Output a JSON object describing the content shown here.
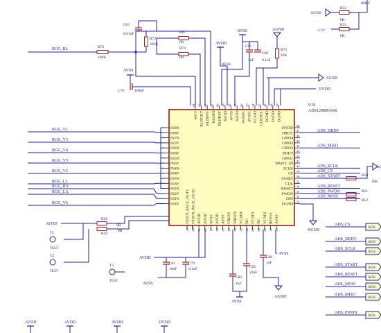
{
  "colors": {
    "wire": "#1c1ca8",
    "component": "#a81c1c",
    "label": "#1c1c80",
    "chip_fill": "#fffdc0",
    "chip_border": "#8a1010",
    "pin": "#1c1c1c",
    "port_fill": "#ffffc8"
  },
  "chip": {
    "ref": "U19",
    "part": "ADS1298IPAGR",
    "pins_left": [
      "IN8N",
      "IN8P",
      "IN7N",
      "IN7P",
      "IN6N",
      "IN6P",
      "IN5N",
      "IN5P",
      "IN4N",
      "IN4P",
      "IN3N",
      "IN3P",
      "IN2N",
      "IN2P",
      "IN1N",
      "IN1P"
    ],
    "pins_top": [
      "WCT",
      "RLDOUT",
      "RLDINV",
      "RLDIN",
      "RLDREF",
      "AVDD",
      "AVSS",
      "AVDD",
      "AVDD1",
      "AVSS1",
      "VCAP3",
      "CLKSEL",
      "DGND",
      "DVDD",
      "DGND"
    ],
    "pins_top_num": [
      "64",
      "63",
      "62",
      "61",
      "60",
      "59",
      "58",
      "57",
      "56",
      "55",
      "54",
      "53",
      "52",
      "51",
      "50"
    ],
    "pins_right": [
      "DVDD",
      "DRDY",
      "GPIO4",
      "GPIO3",
      "GPIO2",
      "DOUT",
      "GPIO1",
      "DAISY_IN",
      "SCLK",
      "CS",
      "START",
      "CLK",
      "RESET",
      "PWDN",
      "DIN",
      "DGND"
    ],
    "pins_right_num": [
      "48",
      "47",
      "46",
      "45",
      "44",
      "43",
      "42",
      "41",
      "40",
      "39",
      "38",
      "37",
      "36",
      "35",
      "34",
      "33"
    ],
    "pins_bottom": [
      "TESTP_PACE_OUT1",
      "TESTN_PACE_OUT2",
      "AVDD",
      "AVDD",
      "AVSS",
      "AVDD",
      "AVSS",
      "VREFP",
      "VREFN",
      "VCAP4",
      "NC",
      "VCAP1",
      "NC",
      "VCAP2",
      "RESV1",
      "AVSS"
    ],
    "pins_bottom_num": [
      "17",
      "18",
      "19",
      "20",
      "21",
      "22",
      "23",
      "24",
      "25",
      "26",
      "27",
      "28",
      "29",
      "30",
      "31",
      "32"
    ]
  },
  "left_nets": [
    "RGG_V1",
    "RGG_V3",
    "RGG_V4",
    "RGG_V5",
    "RGG_V2",
    "RGG_LL",
    "RGG_RA",
    "RGG_LA",
    "RGG_V6"
  ],
  "right_nets": [
    "ADS_DRDY",
    "ADS_MISO",
    "ADS_SCLK",
    "ADS_CS",
    "ADS_START",
    "ADS_RESET",
    "ADS_PWDN",
    "ADS_MOSI"
  ],
  "right_ports": [
    "ADS_CS",
    "ADS_DRDY",
    "ADS_SCLK",
    "ADS_START",
    "ADS_RESET",
    "ADS_MOSI",
    "ADS_MISO",
    "ADS_PWDN"
  ],
  "right_port_label": "ADS",
  "net_top_left": "RGG_RL",
  "components": {
    "c63": {
      "ref": "C63",
      "val": "0.01uF"
    },
    "r72": {
      "ref": "R72",
      "val": "392K"
    },
    "r67": {
      "ref": "R67",
      "val": "0R"
    },
    "r74": {
      "ref": "R74",
      "val": "0R"
    },
    "r73": {
      "ref": "R73",
      "val": "100K"
    },
    "c70": {
      "ref": "C70",
      "val": "100pF"
    },
    "c65": {
      "ref": "C65",
      "val": "1uF"
    },
    "c69": {
      "ref": "C69",
      "val": "0.1uF"
    },
    "r75": {
      "ref": "R75",
      "val": "10K"
    },
    "r53": {
      "ref": "R53",
      "val": "0R"
    },
    "r55": {
      "ref": "R55",
      "val": "0R"
    },
    "r58": {
      "ref": "R58",
      "val": "0R"
    },
    "r59": {
      "ref": "R59",
      "val": "0R"
    },
    "r50": {
      "ref": "R50",
      "val": "10K"
    },
    "r51": {
      "ref": "R51",
      "val": "0R"
    },
    "r52": {
      "ref": "R52",
      "val": "0R"
    },
    "c81": {
      "ref": "C81",
      "val": "10uF"
    },
    "c79": {
      "ref": "C79",
      "val": "0.1uF"
    },
    "c82": {
      "ref": "C82",
      "val": "22uF"
    },
    "c83": {
      "ref": "C83",
      "val": "1uF"
    },
    "c80": {
      "ref": "C80",
      "val": "1uF"
    }
  },
  "tests": [
    {
      "ref": "T1",
      "label": "TEST"
    },
    {
      "ref": "T2",
      "label": "TEST"
    },
    {
      "ref": "T3",
      "label": "TEST"
    }
  ],
  "power": {
    "avss": "AVSS",
    "agnd": "AGND",
    "avdd": "AVDD",
    "dvdd": "DVDD",
    "dgnd": "DGND",
    "neg25": "-2.5V",
    "cap_top": "100nF"
  },
  "bottom_labels": [
    "AVDD",
    "AVDD",
    "AVDD",
    "DVDD"
  ]
}
